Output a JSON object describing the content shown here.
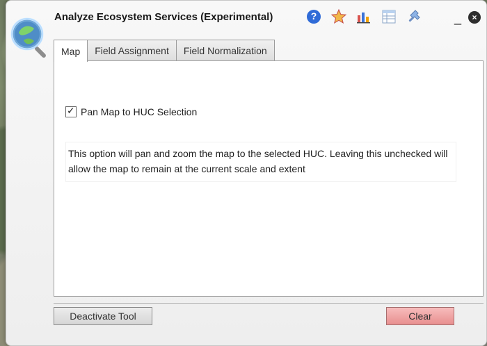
{
  "window": {
    "title": "Analyze Ecosystem Services (Experimental)",
    "close_label": "×",
    "minimize_label": "_"
  },
  "toolbar": {
    "icons": [
      "help-icon",
      "favorite-icon",
      "chart-icon",
      "table-icon",
      "settings-icon"
    ]
  },
  "tabs": [
    {
      "label": "Map",
      "active": true
    },
    {
      "label": "Field Assignment",
      "active": false
    },
    {
      "label": "Field Normalization",
      "active": false
    }
  ],
  "map_tab": {
    "pan_option_label": "Pan Map to HUC Selection",
    "pan_option_checked": true,
    "description": "This option will pan and zoom the map to the selected HUC. Leaving this unchecked will allow the map to remain at the current scale and extent"
  },
  "footer": {
    "deactivate_label": "Deactivate Tool",
    "clear_label": "Clear"
  },
  "colors": {
    "clear_button": "#e88f8f",
    "panel_bg": "#f3f3f3"
  }
}
